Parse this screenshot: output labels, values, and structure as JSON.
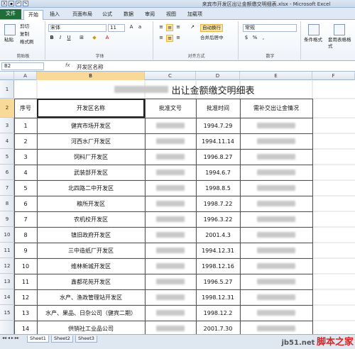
{
  "window": {
    "title": "来宾市开发区出让金额缴交明细表.xlsx - Microsoft Excel"
  },
  "tabs": [
    "文件",
    "开始",
    "插入",
    "页面布局",
    "公式",
    "数据",
    "审阅",
    "视图",
    "加载项"
  ],
  "ribbon": {
    "clipboard": {
      "paste": "粘贴",
      "cut": "剪切",
      "copy": "复制",
      "format_painter": "格式刷",
      "label": "剪贴板"
    },
    "font": {
      "name": "宋体",
      "size": "11",
      "label": "字体"
    },
    "align": {
      "wrap": "自动换行",
      "merge": "合并后居中",
      "label": "对齐方式"
    },
    "number": {
      "format": "常规",
      "label": "数字"
    },
    "styles": {
      "cond": "条件格式",
      "table": "套用表格格式"
    }
  },
  "formula_bar": {
    "name_box": "B2",
    "fx": "fx",
    "content": "开发区名称"
  },
  "columns": [
    "A",
    "B",
    "C",
    "D",
    "E",
    "F"
  ],
  "sheet": {
    "title": "出让金额缴交明细表",
    "headers": [
      "序号",
      "开发区名称",
      "批准文号",
      "批准时间",
      "需补交出让金情况"
    ],
    "rows": [
      {
        "no": "1",
        "name": "健宾市场开发区",
        "date": "1994.7.29"
      },
      {
        "no": "2",
        "name": "河西水厂开发区",
        "date": "1994.11.14"
      },
      {
        "no": "3",
        "name": "饲料厂开发区",
        "date": "1996.8.27"
      },
      {
        "no": "4",
        "name": "武装部开发区",
        "date": "1994.6.7"
      },
      {
        "no": "5",
        "name": "北四路二中开发区",
        "date": "1998.8.5"
      },
      {
        "no": "6",
        "name": "粮所开发区",
        "date": "1998.7.22"
      },
      {
        "no": "7",
        "name": "农机校开发区",
        "date": "1996.3.22"
      },
      {
        "no": "8",
        "name": "镇旧政府开发区",
        "date": "2001.4.3"
      },
      {
        "no": "9",
        "name": "三中造纸厂开发区",
        "date": "1994.12.31"
      },
      {
        "no": "10",
        "name": "维林新城开发区",
        "date": "1998.12.16"
      },
      {
        "no": "11",
        "name": "鑫都花苑开发区",
        "date": "1996.5.27"
      },
      {
        "no": "12",
        "name": "水产、渔政管理站开发区",
        "date": "1998.12.31"
      },
      {
        "no": "13",
        "name": "水产、果品、日杂公司（健宾二期）",
        "date": "1998.12.2"
      },
      {
        "no": "14",
        "name": "供销社工业品公司",
        "date": "2001.7.30"
      }
    ]
  },
  "row_numbers": [
    "1",
    "2",
    "3",
    "4",
    "5",
    "6",
    "7",
    "8",
    "9",
    "10",
    "11",
    "12",
    "13",
    "14",
    "15"
  ],
  "sheet_tabs": [
    "Sheet1",
    "Sheet2",
    "Sheet3"
  ],
  "watermark": {
    "line1": "jb51.net",
    "line2": "脚本之家"
  }
}
